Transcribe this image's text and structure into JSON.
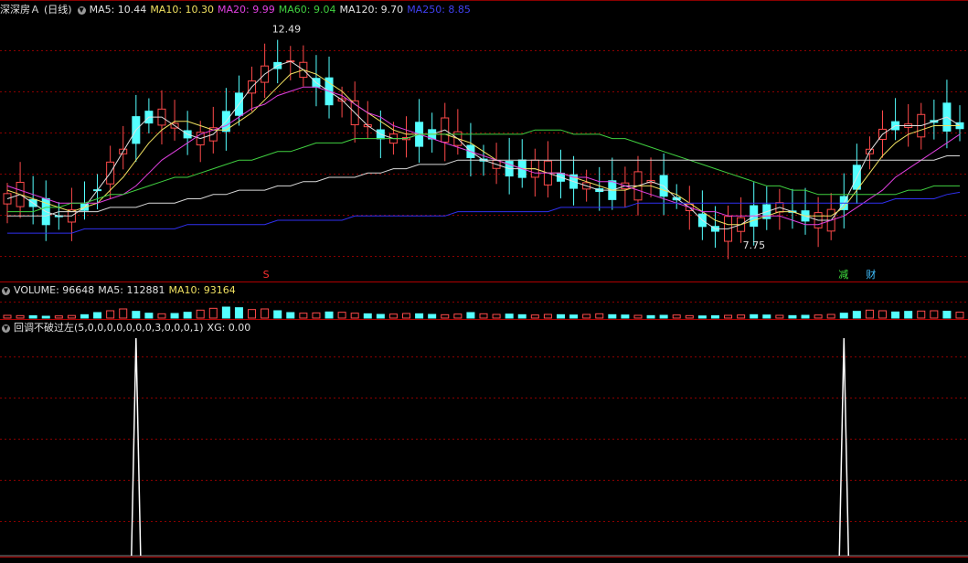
{
  "header": {
    "stock_name": "深深房Ａ",
    "period": "(日线)",
    "ma_items": [
      {
        "label": "MA5: 10.44",
        "color": "#e0e0e0"
      },
      {
        "label": "MA10: 10.30",
        "color": "#f0e060"
      },
      {
        "label": "MA20: 9.99",
        "color": "#e040e0"
      },
      {
        "label": "MA60: 9.04",
        "color": "#40d040"
      },
      {
        "label": "MA120: 9.70",
        "color": "#e0e0e0"
      },
      {
        "label": "MA250: 8.85",
        "color": "#4040f0"
      }
    ]
  },
  "volume_header": {
    "items": [
      {
        "label": "VOLUME: 96648",
        "color": "#e0e0e0"
      },
      {
        "label": "MA5: 112881",
        "color": "#e0e0e0"
      },
      {
        "label": "MA10: 93164",
        "color": "#f0e060"
      }
    ]
  },
  "indicator_header": {
    "formula": "回调不破过左(5,0,0,0,0,0,0,0,3,0,0,0,1)",
    "value": "XG: 0.00"
  },
  "annotations": {
    "high_label": "12.49",
    "low_label": "7.75",
    "marker_s": "S",
    "marker_jian": "减",
    "marker_cai": "财"
  },
  "colors": {
    "up": "#ff4a4a",
    "down": "#54ffff",
    "grid": "#8a0000",
    "ma5": "#e0e0e0",
    "ma10": "#f0e060",
    "ma20": "#e040e0",
    "ma60": "#40d040",
    "ma120": "#d8d8d8",
    "ma250": "#3030f0"
  },
  "chart_data": [
    {
      "type": "candlestick",
      "title": "深深房Ａ (日线)",
      "ylim": [
        7.2,
        12.9
      ],
      "high": 12.49,
      "low": 7.75,
      "series": [
        {
          "name": "MA5",
          "values": [
            8.7,
            8.8,
            8.6,
            8.4,
            8.3,
            8.3,
            8.5,
            8.9,
            9.3,
            9.8,
            10.3,
            10.6,
            10.6,
            10.4,
            10.2,
            10.1,
            10.2,
            10.5,
            10.9,
            11.3,
            11.6,
            11.8,
            11.9,
            11.7,
            11.4,
            11.2,
            11.0,
            10.7,
            10.4,
            10.2,
            10.1,
            10.1,
            10.2,
            10.2,
            10.3,
            10.1,
            9.8,
            9.6,
            9.5,
            9.4,
            9.4,
            9.4,
            9.3,
            9.2,
            9.1,
            9.0,
            8.9,
            8.9,
            9.0,
            9.0,
            9.1,
            9.0,
            8.7,
            8.5,
            8.2,
            8.0,
            8.0,
            8.1,
            8.3,
            8.4,
            8.5,
            8.4,
            8.3,
            8.2,
            8.2,
            8.6,
            9.2,
            9.8,
            10.2,
            10.4,
            10.4,
            10.4,
            10.5,
            10.6,
            10.4
          ]
        },
        {
          "name": "MA10",
          "values": [
            8.9,
            8.8,
            8.7,
            8.6,
            8.5,
            8.4,
            8.5,
            8.6,
            8.9,
            9.2,
            9.6,
            10.0,
            10.3,
            10.5,
            10.5,
            10.4,
            10.3,
            10.3,
            10.5,
            10.7,
            11.0,
            11.3,
            11.6,
            11.7,
            11.6,
            11.4,
            11.2,
            10.9,
            10.7,
            10.5,
            10.3,
            10.2,
            10.2,
            10.2,
            10.2,
            10.1,
            10.0,
            9.8,
            9.6,
            9.5,
            9.4,
            9.4,
            9.3,
            9.3,
            9.2,
            9.1,
            9.0,
            8.9,
            8.9,
            9.0,
            9.0,
            8.9,
            8.8,
            8.6,
            8.4,
            8.2,
            8.1,
            8.1,
            8.2,
            8.3,
            8.4,
            8.4,
            8.3,
            8.3,
            8.3,
            8.5,
            8.9,
            9.3,
            9.7,
            10.0,
            10.2,
            10.3,
            10.4,
            10.4,
            10.4
          ]
        },
        {
          "name": "MA20",
          "values": [
            9.0,
            8.9,
            8.8,
            8.7,
            8.6,
            8.6,
            8.6,
            8.6,
            8.7,
            8.8,
            9.0,
            9.3,
            9.6,
            9.8,
            10.0,
            10.2,
            10.3,
            10.4,
            10.6,
            10.8,
            10.9,
            11.1,
            11.2,
            11.3,
            11.3,
            11.2,
            11.1,
            10.9,
            10.7,
            10.6,
            10.4,
            10.3,
            10.2,
            10.1,
            10.0,
            9.9,
            9.8,
            9.7,
            9.6,
            9.5,
            9.4,
            9.3,
            9.3,
            9.3,
            9.2,
            9.2,
            9.1,
            9.1,
            9.0,
            8.9,
            8.8,
            8.7,
            8.6,
            8.5,
            8.4,
            8.4,
            8.3,
            8.3,
            8.3,
            8.3,
            8.3,
            8.2,
            8.1,
            8.1,
            8.2,
            8.3,
            8.5,
            8.7,
            8.9,
            9.2,
            9.4,
            9.6,
            9.8,
            10.0,
            10.2
          ]
        },
        {
          "name": "MA60",
          "values": [
            8.4,
            8.4,
            8.4,
            8.5,
            8.5,
            8.6,
            8.6,
            8.7,
            8.8,
            8.8,
            8.9,
            9.0,
            9.1,
            9.2,
            9.2,
            9.3,
            9.4,
            9.5,
            9.6,
            9.6,
            9.7,
            9.8,
            9.8,
            9.9,
            10.0,
            10.0,
            10.0,
            10.1,
            10.1,
            10.1,
            10.1,
            10.1,
            10.2,
            10.2,
            10.2,
            10.2,
            10.2,
            10.2,
            10.2,
            10.2,
            10.2,
            10.3,
            10.3,
            10.3,
            10.2,
            10.2,
            10.2,
            10.1,
            10.1,
            10.0,
            9.9,
            9.8,
            9.7,
            9.6,
            9.5,
            9.4,
            9.3,
            9.2,
            9.1,
            9.0,
            9.0,
            8.9,
            8.9,
            8.8,
            8.8,
            8.8,
            8.8,
            8.8,
            8.8,
            8.8,
            8.9,
            8.9,
            9.0,
            9.0,
            9.0
          ]
        },
        {
          "name": "MA120",
          "values": [
            8.3,
            8.3,
            8.3,
            8.3,
            8.4,
            8.4,
            8.4,
            8.4,
            8.5,
            8.5,
            8.5,
            8.6,
            8.6,
            8.6,
            8.7,
            8.7,
            8.8,
            8.8,
            8.9,
            8.9,
            8.9,
            9.0,
            9.0,
            9.1,
            9.1,
            9.2,
            9.2,
            9.2,
            9.3,
            9.3,
            9.4,
            9.4,
            9.5,
            9.5,
            9.5,
            9.6,
            9.6,
            9.6,
            9.6,
            9.6,
            9.6,
            9.6,
            9.6,
            9.6,
            9.6,
            9.6,
            9.6,
            9.6,
            9.6,
            9.6,
            9.6,
            9.6,
            9.6,
            9.6,
            9.6,
            9.6,
            9.6,
            9.6,
            9.6,
            9.6,
            9.6,
            9.6,
            9.6,
            9.6,
            9.6,
            9.6,
            9.6,
            9.6,
            9.6,
            9.6,
            9.6,
            9.6,
            9.6,
            9.7,
            9.7
          ]
        },
        {
          "name": "MA250",
          "values": [
            7.9,
            7.9,
            7.9,
            7.9,
            7.9,
            7.9,
            8.0,
            8.0,
            8.0,
            8.0,
            8.0,
            8.0,
            8.0,
            8.0,
            8.1,
            8.1,
            8.1,
            8.1,
            8.1,
            8.1,
            8.1,
            8.2,
            8.2,
            8.2,
            8.2,
            8.2,
            8.2,
            8.3,
            8.3,
            8.3,
            8.3,
            8.3,
            8.3,
            8.3,
            8.3,
            8.4,
            8.4,
            8.4,
            8.4,
            8.4,
            8.4,
            8.4,
            8.4,
            8.5,
            8.5,
            8.5,
            8.5,
            8.5,
            8.5,
            8.6,
            8.6,
            8.6,
            8.6,
            8.6,
            8.6,
            8.6,
            8.6,
            8.6,
            8.6,
            8.6,
            8.6,
            8.6,
            8.6,
            8.6,
            8.6,
            8.6,
            8.6,
            8.6,
            8.6,
            8.7,
            8.7,
            8.7,
            8.7,
            8.8,
            8.85
          ]
        }
      ]
    },
    {
      "type": "bar",
      "title": "VOLUME",
      "values": [
        45,
        40,
        38,
        30,
        35,
        42,
        55,
        90,
        120,
        150,
        110,
        80,
        70,
        75,
        95,
        130,
        160,
        180,
        170,
        140,
        150,
        120,
        90,
        80,
        85,
        100,
        95,
        80,
        70,
        60,
        65,
        75,
        70,
        60,
        55,
        65,
        90,
        70,
        60,
        65,
        55,
        50,
        60,
        55,
        50,
        60,
        70,
        55,
        50,
        45,
        40,
        45,
        50,
        40,
        35,
        38,
        45,
        50,
        55,
        50,
        45,
        40,
        45,
        50,
        60,
        80,
        110,
        130,
        120,
        100,
        110,
        115,
        120,
        112,
        96.6
      ]
    },
    {
      "type": "line",
      "title": "XG",
      "values": [
        0,
        0,
        0,
        0,
        0,
        0,
        0,
        0,
        0,
        0,
        0,
        0,
        0,
        0,
        0,
        0,
        0,
        0,
        0,
        0,
        0,
        0,
        0,
        0,
        0,
        0,
        0,
        0,
        0,
        0,
        0,
        0,
        0,
        0,
        0,
        0,
        0,
        0,
        0,
        0,
        0,
        0,
        0,
        0,
        0,
        0,
        0,
        0,
        0,
        0,
        0,
        0,
        0,
        0,
        0,
        0,
        0,
        0,
        0,
        0,
        0,
        0,
        0,
        0,
        0,
        0,
        0,
        0,
        0,
        0,
        0,
        0,
        0,
        0,
        0
      ],
      "signals_at": [
        10,
        65
      ],
      "ylim": [
        0,
        1
      ]
    }
  ]
}
